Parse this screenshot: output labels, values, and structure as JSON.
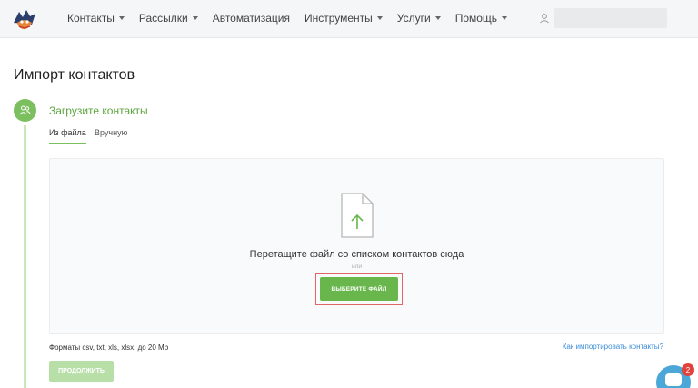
{
  "nav": {
    "items": [
      {
        "label": "Контакты",
        "has_dropdown": true
      },
      {
        "label": "Рассылки",
        "has_dropdown": true
      },
      {
        "label": "Автоматизация",
        "has_dropdown": false
      },
      {
        "label": "Инструменты",
        "has_dropdown": true
      },
      {
        "label": "Услуги",
        "has_dropdown": true
      },
      {
        "label": "Помощь",
        "has_dropdown": true
      }
    ],
    "search_value": ""
  },
  "page": {
    "title": "Импорт контактов"
  },
  "step": {
    "title": "Загрузите контакты",
    "icon": "users-icon"
  },
  "tabs": [
    {
      "label": "Из файла",
      "active": true
    },
    {
      "label": "Вручную",
      "active": false
    }
  ],
  "dropzone": {
    "text": "Перетащите файл со списком контактов сюда",
    "or": "или",
    "choose_button": "ВЫБЕРИТЕ ФАЙЛ"
  },
  "footer": {
    "formats": "Форматы csv, txt, xls, xlsx, до 20 Mb",
    "help_link": "Как импортировать контакты?",
    "continue_button": "ПРОДОЛЖИТЬ"
  },
  "chat": {
    "badge_count": "2"
  },
  "colors": {
    "accent": "#69b74c",
    "link": "#3b8ed9",
    "highlight": "#e06666",
    "badge": "#e0433b"
  }
}
